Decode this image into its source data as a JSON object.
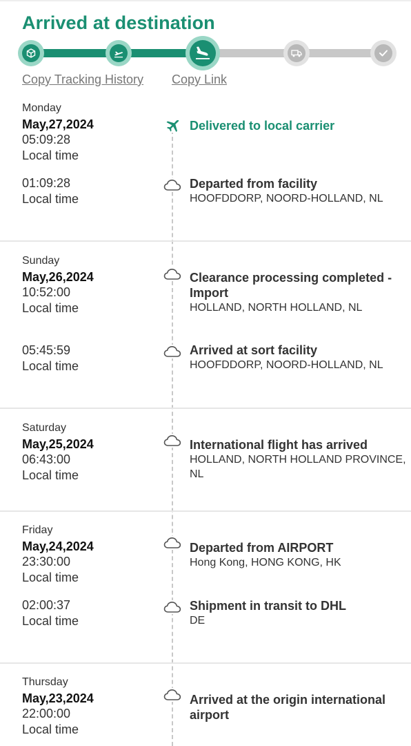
{
  "status_title": "Arrived at destination",
  "progress": {
    "steps": [
      {
        "icon": "package-icon",
        "state": "done"
      },
      {
        "icon": "plane-takeoff-icon",
        "state": "done"
      },
      {
        "icon": "plane-landing-icon",
        "state": "current"
      },
      {
        "icon": "delivery-truck-icon",
        "state": "pending"
      },
      {
        "icon": "checkmark-icon",
        "state": "pending"
      }
    ],
    "accent_color": "#1a8f72",
    "pending_color": "#c8c8c8"
  },
  "links": {
    "copy_history": "Copy Tracking History",
    "copy_link": "Copy Link"
  },
  "groups": [
    {
      "weekday": "Monday",
      "date": "May,27,2024",
      "events": [
        {
          "time": "05:09:28",
          "time_label": "Local time",
          "icon": "airplane-icon",
          "title": "Delivered to local carrier",
          "location": ""
        },
        {
          "time": "01:09:28",
          "time_label": "Local time",
          "icon": "cloud-icon",
          "title": "Departed from facility",
          "location": "HOOFDDORP, NOORD-HOLLAND, NL"
        }
      ]
    },
    {
      "weekday": "Sunday",
      "date": "May,26,2024",
      "events": [
        {
          "time": "10:52:00",
          "time_label": "Local time",
          "icon": "cloud-icon",
          "title": "Clearance processing completed - Import",
          "location": "HOLLAND, NORTH HOLLAND, NL"
        },
        {
          "time": "05:45:59",
          "time_label": "Local time",
          "icon": "cloud-icon",
          "title": "Arrived at sort facility",
          "location": "HOOFDDORP, NOORD-HOLLAND, NL"
        }
      ]
    },
    {
      "weekday": "Saturday",
      "date": "May,25,2024",
      "events": [
        {
          "time": "06:43:00",
          "time_label": "Local time",
          "icon": "cloud-icon",
          "title": "International flight has arrived",
          "location": "HOLLAND, NORTH HOLLAND PROVINCE, NL"
        }
      ]
    },
    {
      "weekday": "Friday",
      "date": "May,24,2024",
      "events": [
        {
          "time": "23:30:00",
          "time_label": "Local time",
          "icon": "cloud-icon",
          "title": "Departed from AIRPORT",
          "location": "Hong Kong, HONG KONG, HK"
        },
        {
          "time": "02:00:37",
          "time_label": "Local time",
          "icon": "cloud-icon",
          "title": "Shipment in transit to DHL",
          "location": "DE"
        }
      ]
    },
    {
      "weekday": "Thursday",
      "date": "May,23,2024",
      "events": [
        {
          "time": "22:00:00",
          "time_label": "Local time",
          "icon": "cloud-icon",
          "title": "Arrived at the origin international airport",
          "location": ""
        }
      ]
    }
  ]
}
